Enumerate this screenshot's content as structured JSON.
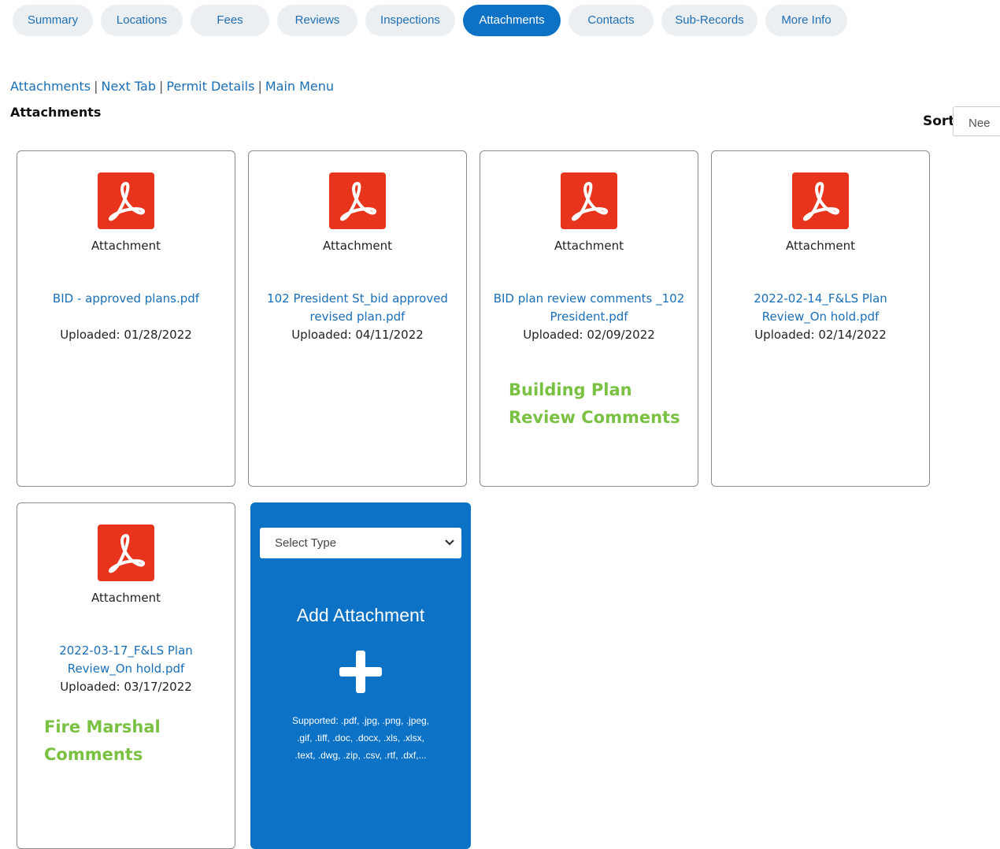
{
  "tabs": [
    {
      "label": "Summary",
      "active": false
    },
    {
      "label": "Locations",
      "active": false
    },
    {
      "label": "Fees",
      "active": false
    },
    {
      "label": "Reviews",
      "active": false
    },
    {
      "label": "Inspections",
      "active": false
    },
    {
      "label": "Attachments",
      "active": true
    },
    {
      "label": "Contacts",
      "active": false
    },
    {
      "label": "Sub-Records",
      "active": false
    },
    {
      "label": "More Info",
      "active": false
    }
  ],
  "links": [
    "Attachments",
    "Next Tab",
    "Permit Details",
    "Main Menu"
  ],
  "section_title": "Attachments",
  "sort": {
    "label": "Sort",
    "value": "Nee"
  },
  "attachments": [
    {
      "type_label": "Attachment",
      "name": "BID - approved plans.pdf",
      "uploaded": "Uploaded: 01/28/2022"
    },
    {
      "type_label": "Attachment",
      "name": "102 President St_bid approved revised plan.pdf",
      "uploaded": "Uploaded: 04/11/2022"
    },
    {
      "type_label": "Attachment",
      "name": "BID plan review comments _102 President.pdf",
      "uploaded": "Uploaded: 02/09/2022",
      "note_line1": "Building Plan",
      "note_line2": "Review Comments"
    },
    {
      "type_label": "Attachment",
      "name": "2022-02-14_F&LS Plan Review_On hold.pdf",
      "uploaded": "Uploaded: 02/14/2022"
    },
    {
      "type_label": "Attachment",
      "name": "2022-03-17_F&LS Plan Review_On hold.pdf",
      "uploaded": "Uploaded: 03/17/2022",
      "note_line1": "Fire Marshal",
      "note_line2": "Comments"
    }
  ],
  "add_card": {
    "select_placeholder": "Select Type",
    "title": "Add Attachment",
    "supported_line1": "Supported: .pdf, .jpg, .png, .jpeg,",
    "supported_line2": ".gif, .tiff, .doc, .docx, .xls, .xlsx,",
    "supported_line3": ".text, .dwg, .zip, .csv, .rtf, .dxf,..."
  },
  "colors": {
    "accent": "#0b72c5",
    "pdf_red": "#e8341c",
    "note_green": "#7ac143",
    "link": "#1a6fb8"
  },
  "icons": {
    "file": "pdf-icon",
    "add": "plus-icon",
    "dropdown": "chevron-down-icon"
  }
}
